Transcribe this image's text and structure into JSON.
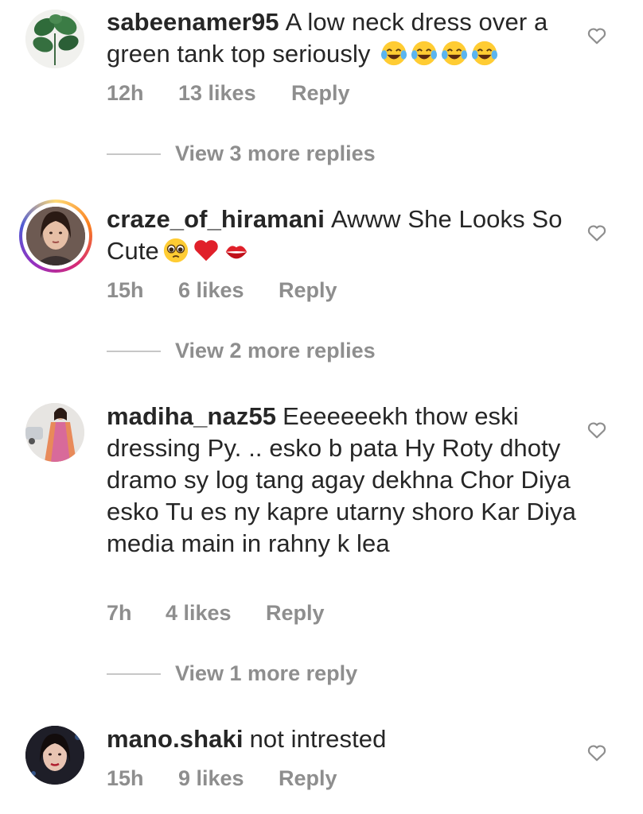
{
  "comments": [
    {
      "username": "sabeenamer95",
      "text": "A low neck dress over a green tank top seriously",
      "emojis": [
        "face-with-tears-of-joy",
        "face-with-tears-of-joy",
        "face-with-tears-of-joy",
        "face-with-tears-of-joy"
      ],
      "time": "12h",
      "likes": "13 likes",
      "reply": "Reply",
      "view_replies": "View 3 more replies"
    },
    {
      "username": "craze_of_hiramani",
      "text": "Awww She Looks So Cute",
      "emojis": [
        "pleading-face",
        "red-heart",
        "kiss-mark"
      ],
      "time": "15h",
      "likes": "6 likes",
      "reply": "Reply",
      "view_replies": "View 2 more replies"
    },
    {
      "username": "madiha_naz55",
      "text": "Eeeeeeekh thow eski dressing Py. .. esko b pata Hy Roty dhoty dramo sy log tang agay dekhna Chor Diya esko Tu es ny kapre utarny shoro Kar Diya media main in rahny k lea",
      "time": "7h",
      "likes": "4 likes",
      "reply": "Reply",
      "view_replies": "View 1 more reply"
    },
    {
      "username": "mano.shaki",
      "text": "not intrested",
      "time": "15h",
      "likes": "9 likes",
      "reply": "Reply"
    }
  ],
  "colors": {
    "text": "#262626",
    "muted": "#8e8e8e",
    "divider": "#c7c7c7",
    "heart_outline": "#8e8e8e"
  }
}
